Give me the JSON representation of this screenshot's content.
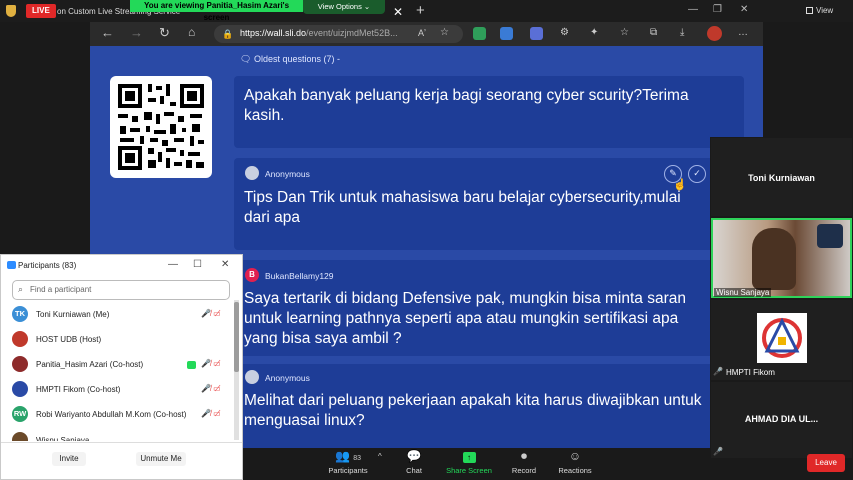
{
  "zoom_top": {
    "live_label": "LIVE",
    "live_status": "on Custom Live Streaming Service",
    "viewing_banner": "You are viewing Panitia_Hasim Azari's screen",
    "view_options": "View Options ⌄",
    "view_label": "View"
  },
  "browser": {
    "url_domain": "https://wall.sli.do",
    "url_path": "/event/uizjmdMet52B..."
  },
  "slido": {
    "sort_label": "Oldest questions (7)",
    "questions": [
      {
        "author": "",
        "text": "Apakah banyak peluang kerja bagi seorang cyber scurity?Terima kasih."
      },
      {
        "author": "Anonymous",
        "text": "Tips Dan Trik untuk mahasiswa baru belajar cybersecurity,mulai dari apa"
      },
      {
        "author": "BukanBellamy129",
        "avatar_letter": "B",
        "text": "Saya tertarik di bidang Defensive pak, mungkin bisa minta saran untuk learning pathnya seperti apa atau mungkin sertifikasi apa yang bisa saya ambil ?"
      },
      {
        "author": "Anonymous",
        "text": "Melihat dari peluang pekerjaan apakah kita harus diwajibkan untuk menguasai linux?"
      }
    ]
  },
  "videos": {
    "tile1_name": "Toni Kurniawan",
    "tile2_label": "Wisnu Sanjaya",
    "tile3_label": "HMPTI Fikom",
    "tile4_name": "AHMAD DIA UL..."
  },
  "toolbar": {
    "participants": "Participants",
    "participants_count": "83",
    "chat": "Chat",
    "share_screen": "Share Screen",
    "record": "Record",
    "reactions": "Reactions",
    "leave": "Leave"
  },
  "participants_panel": {
    "title": "Participants (83)",
    "search_placeholder": "Find a participant",
    "rows": [
      {
        "initials": "TK",
        "color": "#3b8fd6",
        "name": "Toni Kurniawan (Me)"
      },
      {
        "initials": "",
        "color": "#c0392b",
        "name": "HOST UDB (Host)"
      },
      {
        "initials": "",
        "color": "#8e2b2b",
        "name": "Panitia_Hasim Azari (Co-host)"
      },
      {
        "initials": "",
        "color": "#2a4aa6",
        "name": "HMPTI Fikom (Co-host)"
      },
      {
        "initials": "RW",
        "color": "#2aa36b",
        "name": "Robi Wariyanto Abdullah M.Kom (Co-host)"
      },
      {
        "initials": "",
        "color": "#6b4a2a",
        "name": "Wisnu Sanjaya"
      }
    ],
    "invite": "Invite",
    "unmute_me": "Unmute Me"
  }
}
